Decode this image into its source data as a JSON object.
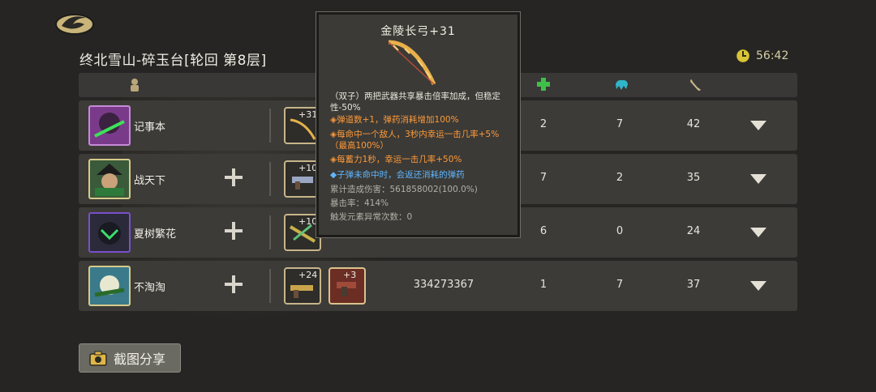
{
  "header": {
    "title": "终北雪山-碎玉台[轮回 第8层]",
    "timer": "56:42"
  },
  "columns": {
    "icons": [
      "person-icon",
      "heal-icon",
      "paw-icon",
      "bone-icon"
    ]
  },
  "rows": [
    {
      "name": "记事本",
      "weapon1_level": "+31",
      "weapon2_level": "",
      "damage": "",
      "heal": "2",
      "pet": "7",
      "bone": "42"
    },
    {
      "name": "战天下",
      "weapon1_level": "+10",
      "weapon2_level": "",
      "damage": "",
      "heal": "7",
      "pet": "2",
      "bone": "35"
    },
    {
      "name": "夏树繁花",
      "weapon1_level": "+10",
      "weapon2_level": "",
      "damage": "",
      "heal": "6",
      "pet": "0",
      "bone": "24"
    },
    {
      "name": "不淘淘",
      "weapon1_level": "+24",
      "weapon2_level": "+3",
      "damage": "334273367",
      "heal": "1",
      "pet": "7",
      "bone": "37"
    }
  ],
  "tooltip": {
    "title": "金陵长弓+31",
    "lines": [
      "（双子）两把武器共享暴击倍率加成，但稳定性-50%",
      "◈弹道数+1，弹药消耗增加100%",
      "◈每命中一个敌人，3秒内幸运一击几率+5%（最高100%）",
      "◈每蓄力1秒，幸运一击几率+50%",
      "◆子弹未命中时，会返还消耗的弹药",
      "累计造成伤害：561858002(100.0%)",
      "暴击率：414%",
      "触发元素异常次数：0"
    ]
  },
  "share": {
    "label": "截图分享"
  },
  "colors": {
    "accent_gold": "#d8c98b",
    "orange": "#ff9a3a",
    "blue": "#5fb6ff",
    "heal_green": "#3fbf4a",
    "pet_cyan": "#2fb6c8"
  }
}
